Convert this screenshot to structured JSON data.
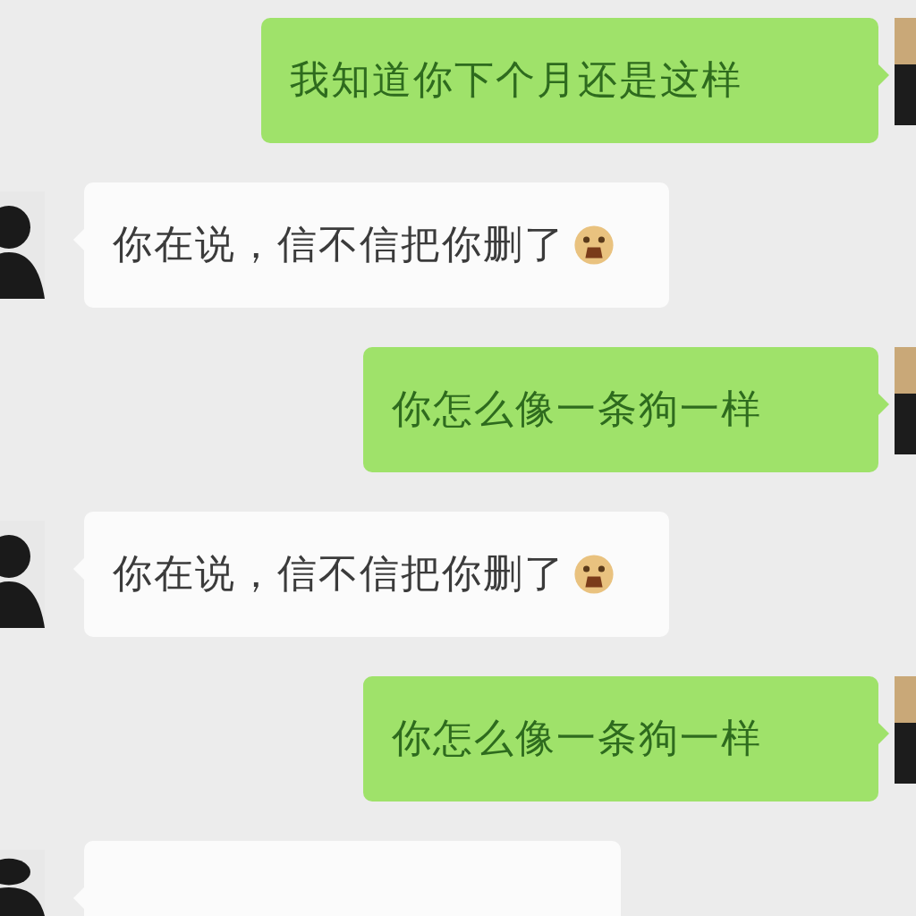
{
  "messages": [
    {
      "kind": "sent",
      "text": "我知道你下个月还是这样",
      "emoji": false
    },
    {
      "kind": "received",
      "text": "你在说，信不信把你删了",
      "emoji": true
    },
    {
      "kind": "sent",
      "text": "你怎么像一条狗一样",
      "emoji": false
    },
    {
      "kind": "received",
      "text": "你在说，信不信把你删了",
      "emoji": true
    },
    {
      "kind": "sent",
      "text": "你怎么像一条狗一样",
      "emoji": false
    },
    {
      "kind": "received",
      "emoji": false
    }
  ]
}
